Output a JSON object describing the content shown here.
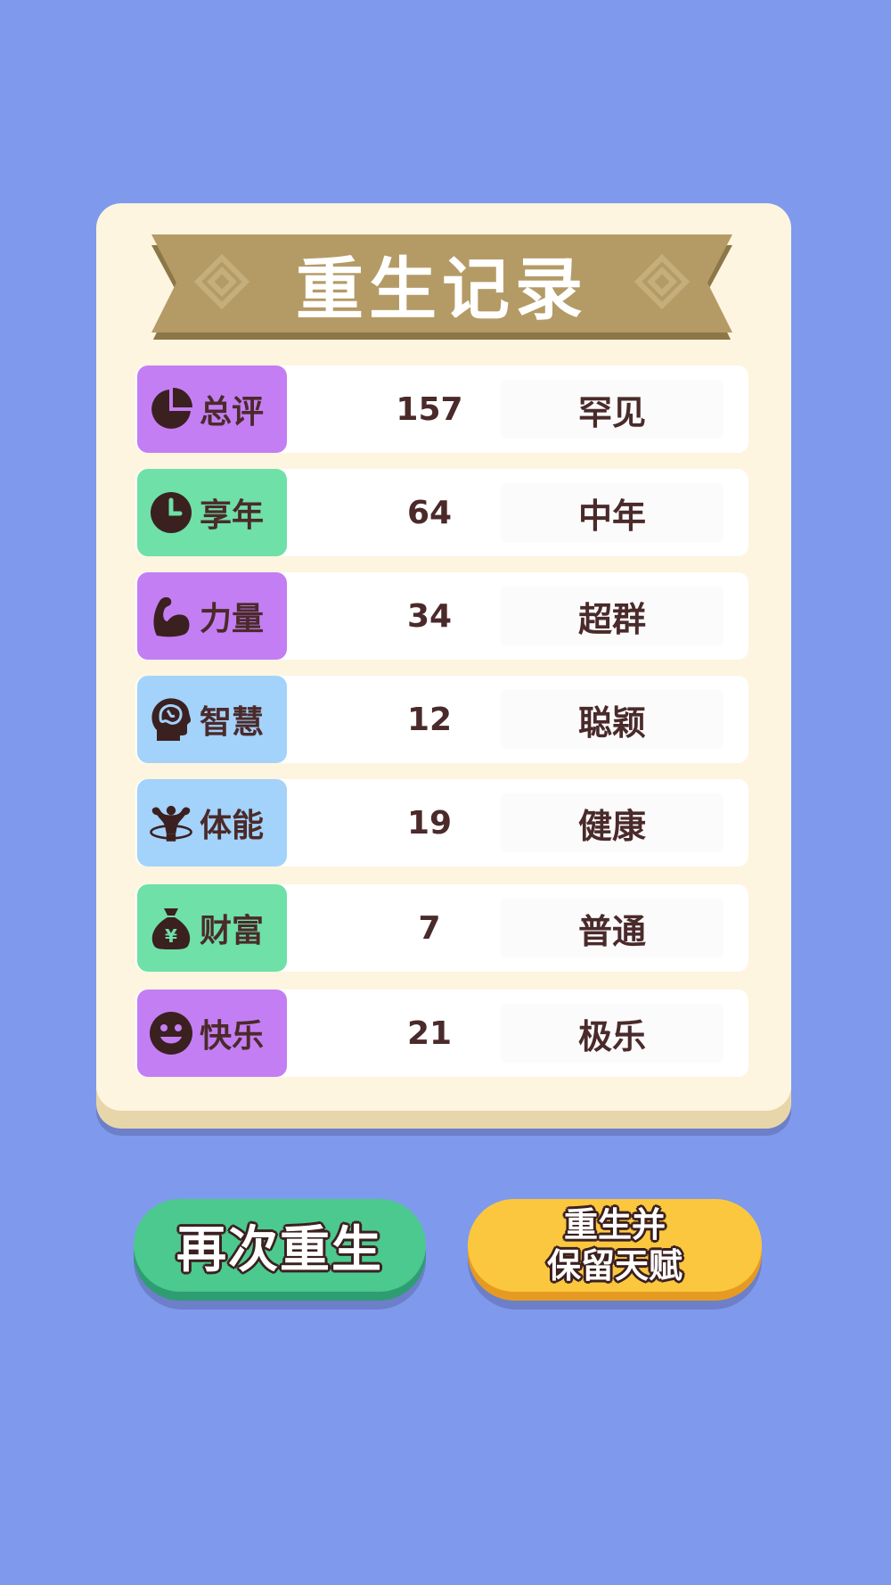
{
  "banner": {
    "title": "重生记录"
  },
  "rows": [
    {
      "label": "总评",
      "value": "157",
      "grade": "罕见",
      "icon": "pie-chart-icon",
      "color": "#c47ef3"
    },
    {
      "label": "享年",
      "value": "64",
      "grade": "中年",
      "icon": "clock-icon",
      "color": "#6ee0a8"
    },
    {
      "label": "力量",
      "value": "34",
      "grade": "超群",
      "icon": "flexed-arm-icon",
      "color": "#c47ef3"
    },
    {
      "label": "智慧",
      "value": "12",
      "grade": "聪颖",
      "icon": "brain-head-icon",
      "color": "#a3d2fb"
    },
    {
      "label": "体能",
      "value": "19",
      "grade": "健康",
      "icon": "muscle-man-icon",
      "color": "#a3d2fb"
    },
    {
      "label": "财富",
      "value": "7",
      "grade": "普通",
      "icon": "money-bag-icon",
      "color": "#6ee0a8"
    },
    {
      "label": "快乐",
      "value": "21",
      "grade": "极乐",
      "icon": "smiley-face-icon",
      "color": "#c47ef3"
    }
  ],
  "buttons": {
    "rebirth_again": "再次重生",
    "rebirth_keep_line1": "重生并",
    "rebirth_keep_line2": "保留天赋"
  },
  "colors": {
    "background": "#7f9aec",
    "card": "#fdf5df",
    "banner": "#b49b66",
    "purple_tag": "#c47ef3",
    "green_tag": "#6ee0a8",
    "blue_tag": "#a3d2fb",
    "green_button": "#4cc98e",
    "yellow_button": "#fbc73e",
    "text_dark": "#4a2a2a"
  }
}
